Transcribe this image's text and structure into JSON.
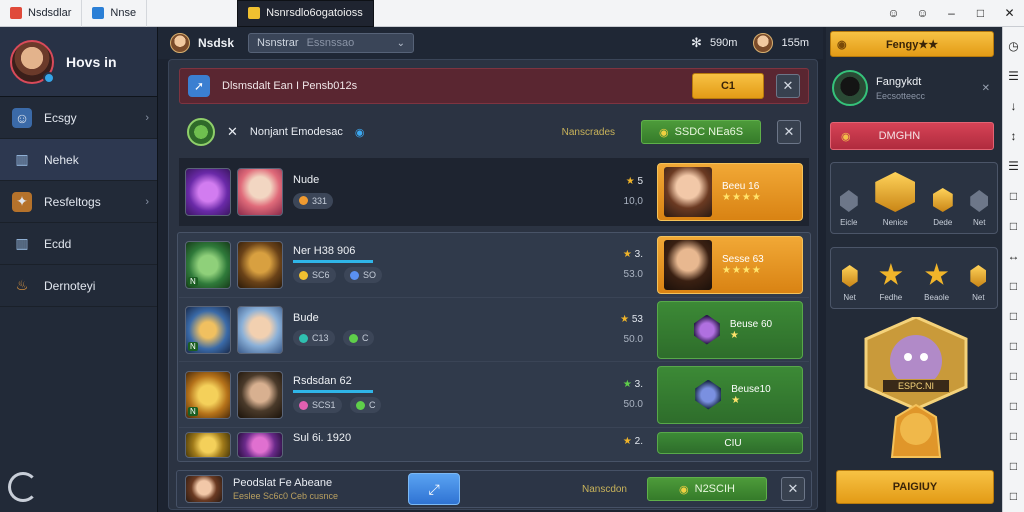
{
  "window": {
    "tabs": [
      {
        "label": "Nsdsdlar",
        "icon": "app-logo-icon",
        "color": "#e04a3a"
      },
      {
        "label": "Nnse",
        "icon": "app-icon",
        "color": "#2b7fd6"
      },
      {
        "label": "Nsnrsdlo6ogatoioss",
        "icon": "game-icon",
        "color": "#f0c030"
      }
    ],
    "controls": [
      "☺",
      "☺",
      "–",
      "□",
      "✕"
    ]
  },
  "sidebar": {
    "profile_name": "Hovs in",
    "items": [
      {
        "label": "Ecsgy",
        "icon": "face-icon",
        "has_chevron": true
      },
      {
        "label": "Nehek",
        "icon": "building-icon",
        "has_chevron": false
      },
      {
        "label": "Resfeltogs",
        "icon": "hero-icon",
        "has_chevron": true
      },
      {
        "label": "Ecdd",
        "icon": "tower-icon",
        "has_chevron": false
      },
      {
        "label": "Dernoteyi",
        "icon": "flame-icon",
        "has_chevron": false
      }
    ]
  },
  "topbar": {
    "name": "Nsdsk",
    "select_value": "Nsnstrar",
    "select_value_2": "Essnssao",
    "stat_1": "590m",
    "stat_2": "155m"
  },
  "alert": {
    "text": "Dlsmsdalt Ean I Pensb012s",
    "button": "C1"
  },
  "rowhead": {
    "label": "Nonjant Emodesac",
    "status": "Nanscrades",
    "button": "SSDC NEa6S"
  },
  "rows": [
    {
      "title": "Nude",
      "pill_1": "331",
      "rank": "5",
      "sub": "10,0",
      "card_title": "Beeu 16",
      "card_stars": "★★★★",
      "card_type": "gold"
    },
    {
      "title": "Ner H38 906",
      "pill_1": "SC6",
      "pill_2": "SO",
      "rank": "3.",
      "sub": "53.0",
      "card_title": "Sesse 63",
      "card_stars": "★★★★",
      "card_type": "gold"
    },
    {
      "title": "Bude",
      "pill_1": "C13",
      "pill_2": "C",
      "rank": "53",
      "sub": "50.0",
      "card_title": "Beuse 60",
      "card_stars": "★",
      "card_type": "green"
    },
    {
      "title": "Rsdsdan 62",
      "pill_1": "SCS1",
      "pill_2": "C",
      "rank": "3.",
      "sub": "50.0",
      "card_title": "Beuse10",
      "card_stars": "★",
      "card_type": "green"
    },
    {
      "title": "Sul 6i. 1920",
      "rank": "2.",
      "sub": "",
      "card_title": "CIU",
      "card_type": "green"
    }
  ],
  "bottom_bar": {
    "title": "Peodslat Fe Abeane",
    "subtitle": "Eeslee Sc6c0 Ceb cusnce",
    "status": "Nanscdon",
    "button": "N2SCIH"
  },
  "right": {
    "top_button": "Fengy★★",
    "profile_name": "Fangykdt",
    "profile_sub": "Eecsotteecc",
    "red_button": "DMGHN",
    "ach_top": [
      "Eicle",
      "Nenice",
      "Dede",
      "Net"
    ],
    "ach_bottom": [
      "Net",
      "Fedhe",
      "Beaole",
      "Net"
    ],
    "hero_banner": "ESPC.NI",
    "bottom_button": "PAIGIUY"
  },
  "tools": [
    "◷",
    "☰",
    "↓",
    "↕",
    "☰",
    "□",
    "□",
    "↔",
    "□",
    "□",
    "□",
    "□",
    "□",
    "□",
    "□",
    "□"
  ]
}
